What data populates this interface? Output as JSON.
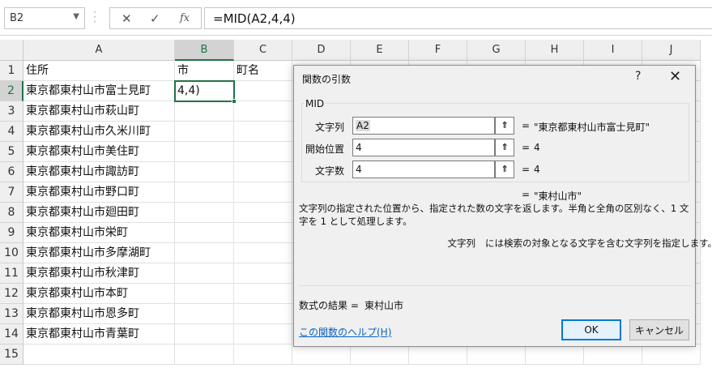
{
  "formula_bar": {
    "name_box": "B2",
    "cancel_icon": "✕",
    "enter_icon": "✓",
    "fx_icon": "fx",
    "formula": "=MID(A2,4,4)"
  },
  "columns": [
    "A",
    "B",
    "C",
    "D",
    "E",
    "F",
    "G",
    "H",
    "I",
    "J"
  ],
  "rows": [
    "1",
    "2",
    "3",
    "4",
    "5",
    "6",
    "7",
    "8",
    "9",
    "10",
    "11",
    "12",
    "13",
    "14",
    "15"
  ],
  "cells": {
    "A1": "住所",
    "B1": "市",
    "C1": "町名",
    "A2": "東京都東村山市富士見町",
    "B2": "4,4)",
    "A3": "東京都東村山市萩山町",
    "A4": "東京都東村山市久米川町",
    "A5": "東京都東村山市美住町",
    "A6": "東京都東村山市諏訪町",
    "A7": "東京都東村山市野口町",
    "A8": "東京都東村山市廻田町",
    "A9": "東京都東村山市栄町",
    "A10": "東京都東村山市多摩湖町",
    "A11": "東京都東村山市秋津町",
    "A12": "東京都東村山市本町",
    "A13": "東京都東村山市恩多町",
    "A14": "東京都東村山市青葉町"
  },
  "dialog": {
    "title": "関数の引数",
    "help": "?",
    "close": "✕",
    "function_name": "MID",
    "args": [
      {
        "label": "文字列",
        "value": "A2",
        "result": "\"東京都東村山市富士見町\""
      },
      {
        "label": "開始位置",
        "value": "4",
        "result": "4"
      },
      {
        "label": "文字数",
        "value": "4",
        "result": "4"
      }
    ],
    "eq": "=",
    "overall_result": "\"東村山市\"",
    "description": "文字列の指定された位置から、指定された数の文字を返します。半角と全角の区別なく、1 文字を 1 として処理します。",
    "arg_desc_name": "文字列",
    "arg_desc": "には検索の対象となる文字を含む文字列を指定します。",
    "result_label": "数式の結果 =",
    "result_value": "東村山市",
    "help_link": "この関数のヘルプ(H)",
    "ok": "OK",
    "cancel": "キャンセル",
    "collapse_icon": "⇑"
  }
}
